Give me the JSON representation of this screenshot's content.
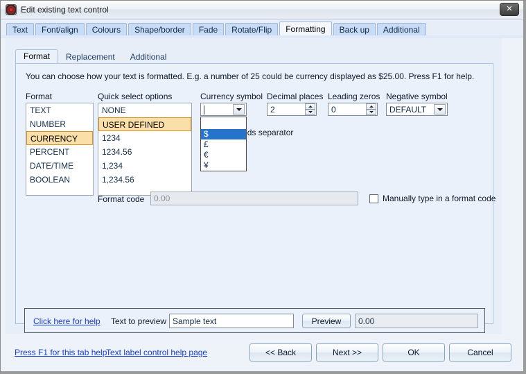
{
  "window": {
    "title": "Edit existing text control",
    "app_icon": "target-icon",
    "close_label": "✕"
  },
  "outer_tabs": [
    {
      "label": "Text",
      "active": false
    },
    {
      "label": "Font/align",
      "active": false
    },
    {
      "label": "Colours",
      "active": false
    },
    {
      "label": "Shape/border",
      "active": false
    },
    {
      "label": "Fade",
      "active": false
    },
    {
      "label": "Rotate/Flip",
      "active": false
    },
    {
      "label": "Formatting",
      "active": true
    },
    {
      "label": "Back up",
      "active": false
    },
    {
      "label": "Additional",
      "active": false
    }
  ],
  "inner_tabs": [
    {
      "label": "Format",
      "active": true
    },
    {
      "label": "Replacement",
      "active": false
    },
    {
      "label": "Additional",
      "active": false
    }
  ],
  "description": "You can choose how your text is formatted.  E.g. a number of 25 could be currency displayed as $25.00.  Press F1 for help.",
  "format": {
    "label": "Format",
    "items": [
      "TEXT",
      "NUMBER",
      "CURRENCY",
      "PERCENT",
      "DATE/TIME",
      "BOOLEAN"
    ],
    "selected": "CURRENCY"
  },
  "quick_select": {
    "label": "Quick select options",
    "items": [
      "NONE",
      "USER DEFINED",
      "1234",
      "1234.56",
      "1,234",
      "1,234.56"
    ],
    "selected": "USER DEFINED"
  },
  "currency_symbol": {
    "label": "Currency symbol",
    "value": "",
    "open": true,
    "options": [
      "",
      "$",
      "£",
      "€",
      "¥"
    ],
    "highlighted": "$"
  },
  "decimal_places": {
    "label": "Decimal places",
    "value": "2"
  },
  "leading_zeros": {
    "label": "Leading zeros",
    "value": "0"
  },
  "negative_symbol": {
    "label": "Negative symbol",
    "value": "DEFAULT"
  },
  "thousands_separator": {
    "label": "Thousands separator",
    "visible_label": "nds separator",
    "checked": false
  },
  "format_code": {
    "label": "Format code",
    "value": "0.00",
    "disabled": true
  },
  "manual_format_code": {
    "label": "Manually type in a format code",
    "checked": false
  },
  "preview": {
    "help_link": "Click here for help",
    "text_to_preview_label": "Text to preview",
    "text_to_preview_value": "Sample text",
    "preview_button": "Preview",
    "result_value": "0.00"
  },
  "footer": {
    "links": [
      "Press F1 for this tab help",
      "Text label control help page"
    ],
    "buttons": [
      "<< Back",
      "Next >>",
      "OK",
      "Cancel"
    ]
  },
  "colors": {
    "selection_orange": "#fbdfa8",
    "selection_orange_border": "#e0932a",
    "dropdown_highlight": "#2673cc",
    "panel_blue": "#eaf1fb",
    "tab_blue": "#c8ddf5"
  }
}
